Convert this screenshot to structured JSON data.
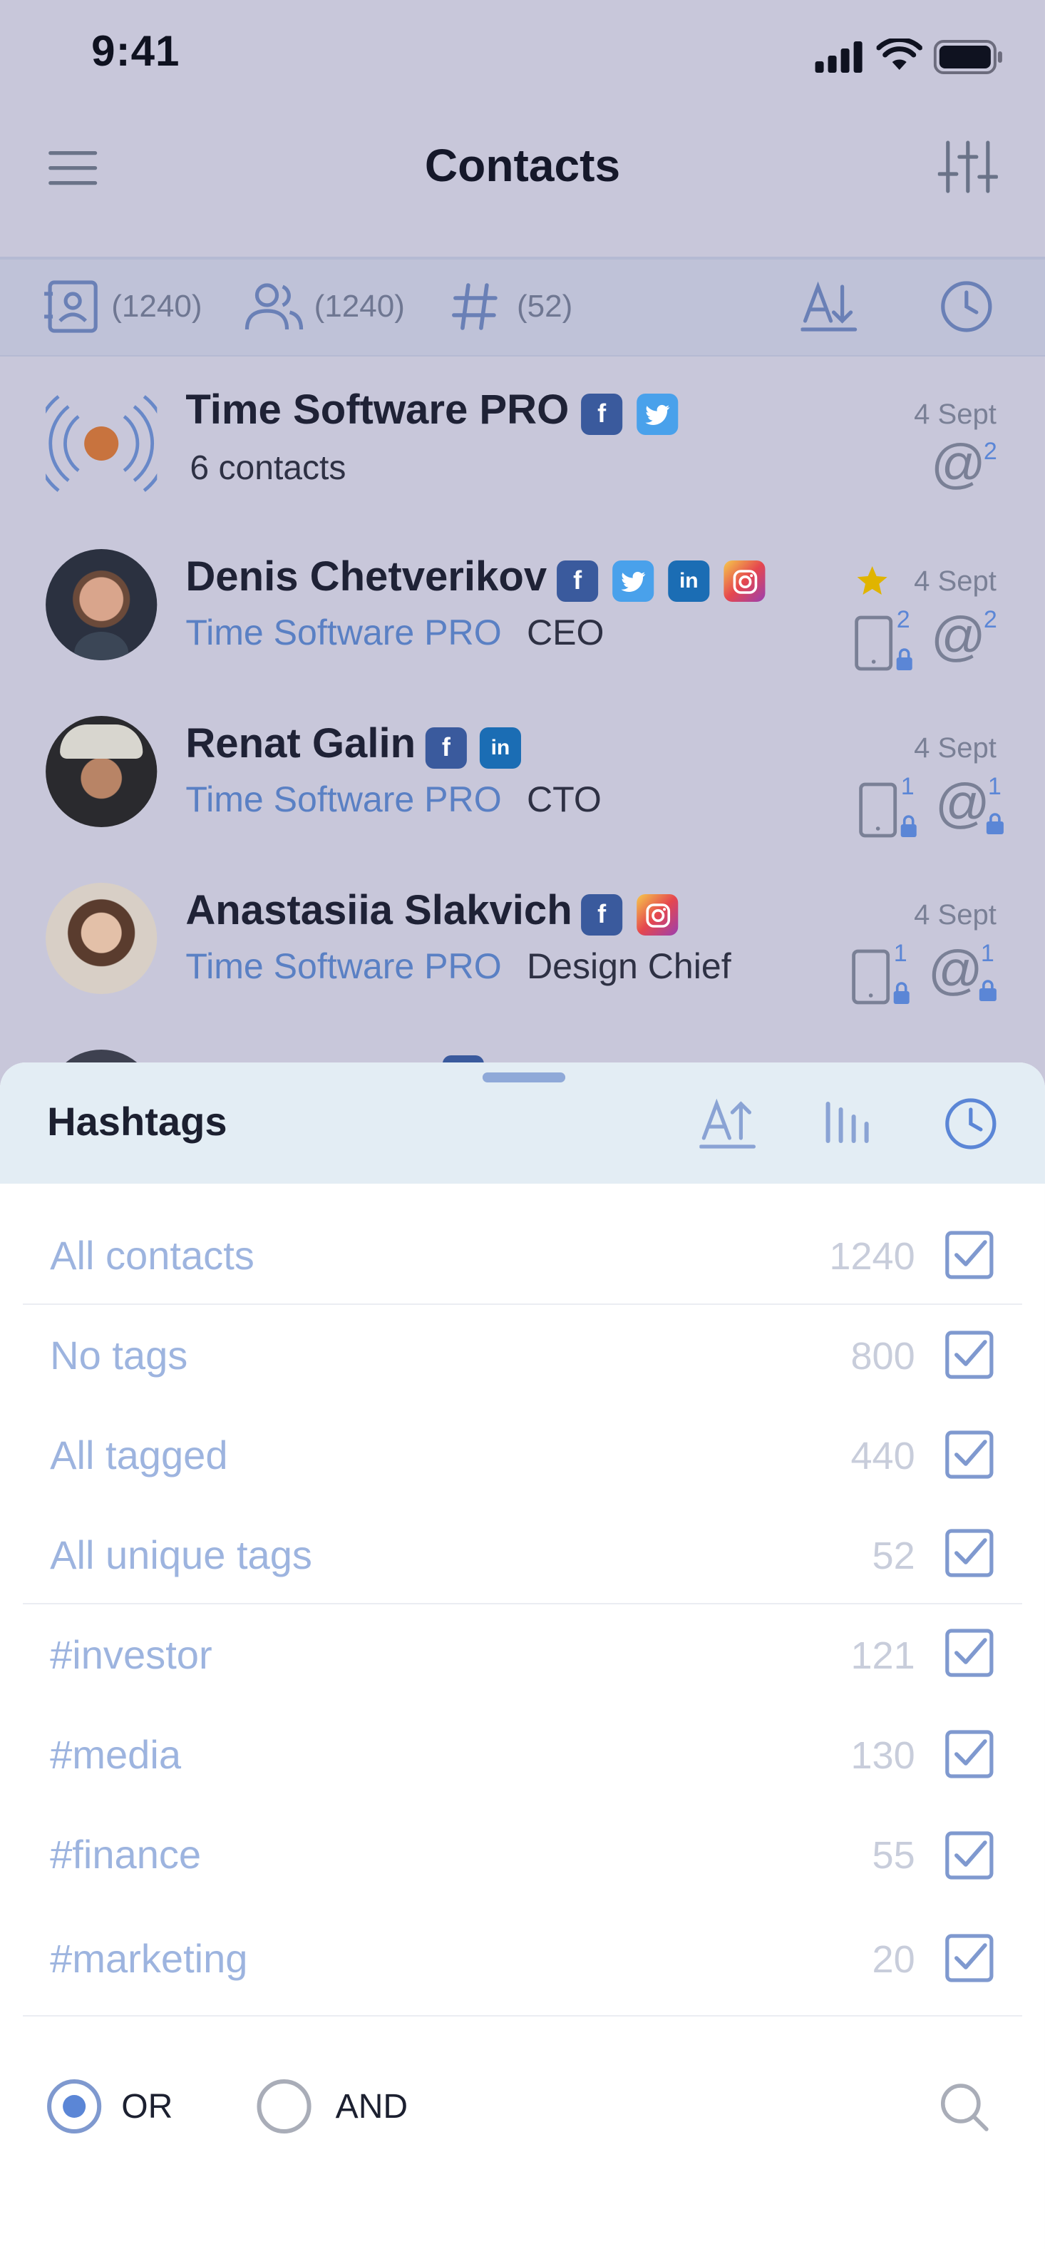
{
  "status_bar": {
    "time": "9:41"
  },
  "header": {
    "title": "Contacts"
  },
  "filter_bar": {
    "contacts_count": "(1240)",
    "people_count": "(1240)",
    "hashtags_count": "(52)"
  },
  "contacts": [
    {
      "name": "Time Software PRO",
      "subtitle": "6 contacts",
      "date": "4 Sept",
      "email_count": "2"
    },
    {
      "name": "Denis Chetverikov",
      "company": "Time Software PRO",
      "role": "CEO",
      "date": "4 Sept",
      "phone_count": "2",
      "email_count": "2"
    },
    {
      "name": "Renat Galin",
      "company": "Time Software PRO",
      "role": "CTO",
      "date": "4 Sept",
      "phone_count": "1",
      "email_count": "1"
    },
    {
      "name": "Anastasiia Slakvich",
      "company": "Time Software PRO",
      "role": "Design Chief",
      "date": "4 Sept",
      "phone_count": "1",
      "email_count": "1"
    }
  ],
  "sheet": {
    "title": "Hashtags",
    "items": [
      {
        "label": "All contacts",
        "count": "1240",
        "checked": true
      },
      {
        "label": "No tags",
        "count": "800",
        "checked": true
      },
      {
        "label": "All tagged",
        "count": "440",
        "checked": true
      },
      {
        "label": "All unique tags",
        "count": "52",
        "checked": true
      },
      {
        "label": "#investor",
        "count": "121",
        "checked": true
      },
      {
        "label": "#media",
        "count": "130",
        "checked": true
      },
      {
        "label": "#finance",
        "count": "55",
        "checked": true
      },
      {
        "label": "#marketing",
        "count": "20",
        "checked": true
      }
    ],
    "logic": {
      "or_label": "OR",
      "and_label": "AND",
      "selected": "OR"
    }
  },
  "colors": {
    "accent": "#5b86d6",
    "overlay": "#c8c7da",
    "sheet_header": "#e3edf4",
    "star": "#e0b400"
  },
  "icons": {
    "menu": "hamburger-icon",
    "filters": "sliders-icon",
    "contacts_tab": "contact-card-icon",
    "people_tab": "people-icon",
    "hashtag_tab": "hashtag-icon",
    "sort": "sort-alpha-icon",
    "recent": "clock-icon",
    "search": "search-icon"
  }
}
